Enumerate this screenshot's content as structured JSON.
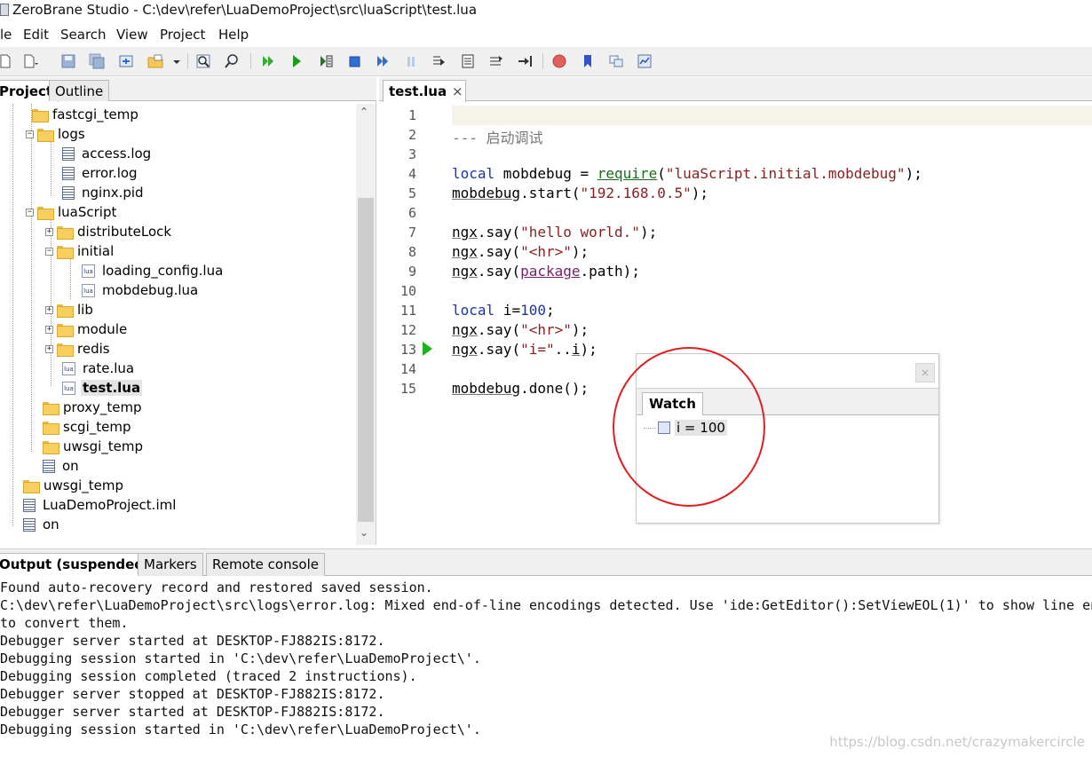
{
  "window": {
    "title": "ZeroBrane Studio - C:\\dev\\refer\\LuaDemoProject\\src\\luaScript\\test.lua"
  },
  "menu": [
    "le",
    "Edit",
    "Search",
    "View",
    "Project",
    "Help"
  ],
  "toolbar_icons": [
    "new-file-icon",
    "new-file-dropdown-icon",
    "save-icon",
    "save-all-icon",
    "open-file-icon",
    "project-directory-icon",
    "project-dropdown-icon",
    "find-icon",
    "find-in-files-icon",
    "run-icon",
    "debug-start-icon",
    "step-over-icon",
    "stop-icon",
    "step-into-icon",
    "pause-icon",
    "step-out-icon",
    "run-to-cursor-icon",
    "trace-icon",
    "detach-icon",
    "breakpoint-icon",
    "bookmark-icon",
    "stack-window-icon",
    "watch-window-icon"
  ],
  "project_panel": {
    "tabs": [
      "Project",
      "Outline"
    ],
    "tree": [
      {
        "label": "fastcgi_temp",
        "type": "folder"
      },
      {
        "label": "logs",
        "type": "folder"
      },
      {
        "label": "access.log",
        "type": "file"
      },
      {
        "label": "error.log",
        "type": "file"
      },
      {
        "label": "nginx.pid",
        "type": "file"
      },
      {
        "label": "luaScript",
        "type": "folder"
      },
      {
        "label": "distributeLock",
        "type": "folder"
      },
      {
        "label": "initial",
        "type": "folder"
      },
      {
        "label": "loading_config.lua",
        "type": "lua"
      },
      {
        "label": "mobdebug.lua",
        "type": "lua"
      },
      {
        "label": "lib",
        "type": "folder"
      },
      {
        "label": "module",
        "type": "folder"
      },
      {
        "label": "redis",
        "type": "folder"
      },
      {
        "label": "rate.lua",
        "type": "lua"
      },
      {
        "label": "test.lua",
        "type": "lua"
      },
      {
        "label": "proxy_temp",
        "type": "folder"
      },
      {
        "label": "scgi_temp",
        "type": "folder"
      },
      {
        "label": "uwsgi_temp",
        "type": "folder"
      },
      {
        "label": "on",
        "type": "file"
      },
      {
        "label": "uwsgi_temp",
        "type": "folder"
      },
      {
        "label": "LuaDemoProject.iml",
        "type": "file"
      },
      {
        "label": "on",
        "type": "file"
      }
    ],
    "lua_icon_text": "lua"
  },
  "editor": {
    "tab": "test.lua",
    "tab_close": "×",
    "line_numbers": [
      "1",
      "2",
      "3",
      "4",
      "5",
      "6",
      "7",
      "8",
      "9",
      "10",
      "11",
      "12",
      "13",
      "14",
      "15"
    ],
    "current_line": 13
  },
  "watch": {
    "close_label": "×",
    "tab": "Watch",
    "item": "i = 100"
  },
  "output": {
    "tabs": [
      "Output (suspended)",
      "Markers",
      "Remote console"
    ],
    "lines": [
      "Found auto-recovery record and restored saved session.",
      "C:\\dev\\refer\\LuaDemoProject\\src\\logs\\error.log: Mixed end-of-line encodings detected. Use 'ide:GetEditor():SetViewEOL(1)' to show line en",
      "to convert them.",
      "Debugger server started at DESKTOP-FJ882IS:8172.",
      "Debugging session started in 'C:\\dev\\refer\\LuaDemoProject\\'.",
      "Debugging session completed (traced 2 instructions).",
      "Debugger server stopped at DESKTOP-FJ882IS:8172.",
      "Debugger server started at DESKTOP-FJ882IS:8172.",
      "Debugging session started in 'C:\\dev\\refer\\LuaDemoProject\\'."
    ]
  },
  "watermark": "https://blog.csdn.net/crazymakercircle",
  "colors": {
    "keyword": "#1a35a8",
    "string": "#8a1f1f",
    "comment": "#777777",
    "breakpoint_arrow": "#1db31d",
    "highlight_ring": "#e02020"
  }
}
